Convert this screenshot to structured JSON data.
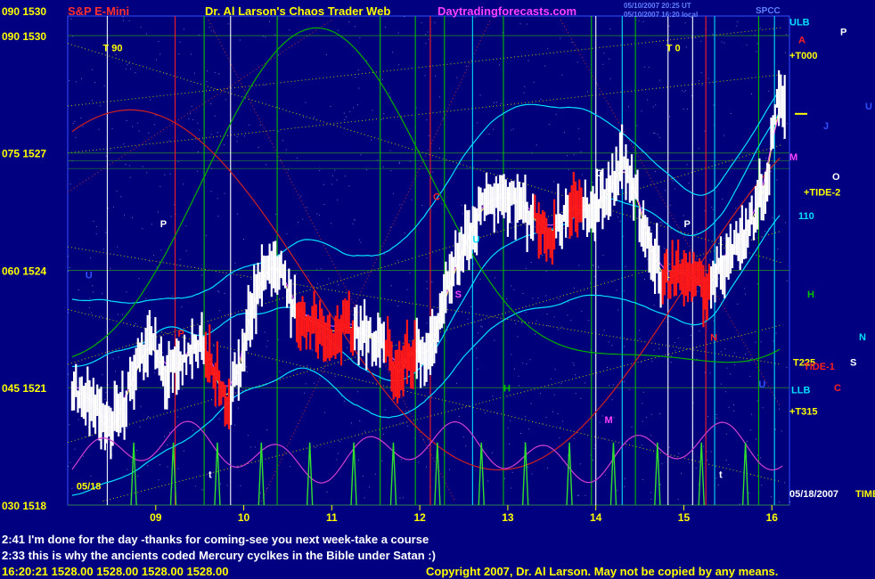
{
  "header": {
    "top_left_price": "090 1530",
    "symbol": "S&P E-Mini",
    "title": "Dr. Al Larson's Chaos Trader Web",
    "site": "Daytradingforecasts.com",
    "stamp1": "05/10/2007 20:25 UT",
    "stamp2": "05/10/2007 16:20 local",
    "corner": "SPCC"
  },
  "colors": {
    "bg": "#000080",
    "panel": "#00007a",
    "white": "#ffffff",
    "yellow": "#ffff00",
    "red": "#ff2020",
    "cyan": "#00e0ff",
    "green": "#00c000",
    "magenta": "#ff40ff",
    "orange": "#ff8000",
    "grid": "#3050ff",
    "copyright": "#ffff00"
  },
  "chart_data": {
    "type": "bar",
    "instrument": "S&P E-Mini",
    "price_axis": [
      {
        "label": "090 1530",
        "price": 1530
      },
      {
        "label": "075 1527",
        "price": 1527
      },
      {
        "label": "060 1524",
        "price": 1524
      },
      {
        "label": "045 1521",
        "price": 1521
      },
      {
        "label": "030 1518",
        "price": 1518
      }
    ],
    "time_axis": [
      "09",
      "10",
      "11",
      "12",
      "13",
      "14",
      "15",
      "16"
    ],
    "ylim": [
      1518,
      1530.5
    ],
    "xlim": [
      8.0,
      16.2
    ],
    "close_path": [
      [
        8.05,
        1521
      ],
      [
        8.3,
        1520.6
      ],
      [
        8.45,
        1519.8
      ],
      [
        8.6,
        1520.4
      ],
      [
        8.8,
        1521.6
      ],
      [
        8.95,
        1522.2
      ],
      [
        9.1,
        1521.3
      ],
      [
        9.3,
        1521.6
      ],
      [
        9.5,
        1522.3
      ],
      [
        9.65,
        1521.4
      ],
      [
        9.8,
        1520.6
      ],
      [
        9.95,
        1521.5
      ],
      [
        10.1,
        1523.2
      ],
      [
        10.3,
        1524.2
      ],
      [
        10.45,
        1523.8
      ],
      [
        10.6,
        1522.8
      ],
      [
        10.8,
        1522.7
      ],
      [
        11.0,
        1522.4
      ],
      [
        11.2,
        1522.6
      ],
      [
        11.4,
        1522.3
      ],
      [
        11.6,
        1522.1
      ],
      [
        11.75,
        1521.2
      ],
      [
        11.9,
        1522.0
      ],
      [
        12.1,
        1521.8
      ],
      [
        12.3,
        1523.4
      ],
      [
        12.5,
        1524.6
      ],
      [
        12.7,
        1525.6
      ],
      [
        12.9,
        1525.9
      ],
      [
        13.1,
        1525.8
      ],
      [
        13.3,
        1525.3
      ],
      [
        13.5,
        1524.9
      ],
      [
        13.7,
        1525.6
      ],
      [
        13.9,
        1525.5
      ],
      [
        14.1,
        1525.8
      ],
      [
        14.3,
        1526.7
      ],
      [
        14.45,
        1526.0
      ],
      [
        14.6,
        1524.6
      ],
      [
        14.8,
        1523.7
      ],
      [
        14.95,
        1524.0
      ],
      [
        15.1,
        1523.8
      ],
      [
        15.25,
        1523.4
      ],
      [
        15.4,
        1524.2
      ],
      [
        15.6,
        1524.6
      ],
      [
        15.8,
        1525.4
      ],
      [
        15.95,
        1526.4
      ],
      [
        16.05,
        1528.2
      ],
      [
        16.15,
        1528.3
      ]
    ],
    "red_bar_zones": [
      [
        9.55,
        9.85
      ],
      [
        10.6,
        11.25
      ],
      [
        11.6,
        11.95
      ],
      [
        13.3,
        13.55
      ],
      [
        13.7,
        13.85
      ],
      [
        14.75,
        15.3
      ]
    ],
    "last": {
      "time": "16:20:21",
      "open": 1528.0,
      "high": 1528.0,
      "low": 1528.0,
      "close": 1528.0
    }
  },
  "overlays": {
    "time_lines": [
      {
        "t": 8.45,
        "color": "white"
      },
      {
        "t": 9.22,
        "color": "red"
      },
      {
        "t": 9.55,
        "color": "green"
      },
      {
        "t": 9.85,
        "color": "white"
      },
      {
        "t": 10.38,
        "color": "green"
      },
      {
        "t": 11.55,
        "color": "green"
      },
      {
        "t": 11.95,
        "color": "green"
      },
      {
        "t": 12.12,
        "color": "red"
      },
      {
        "t": 12.28,
        "color": "green"
      },
      {
        "t": 12.6,
        "color": "cyan"
      },
      {
        "t": 12.95,
        "color": "green"
      },
      {
        "t": 13.95,
        "color": "green"
      },
      {
        "t": 14.0,
        "color": "white"
      },
      {
        "t": 14.3,
        "color": "cyan"
      },
      {
        "t": 14.45,
        "color": "green"
      },
      {
        "t": 14.82,
        "color": "white"
      },
      {
        "t": 15.1,
        "color": "white"
      },
      {
        "t": 15.25,
        "color": "red"
      },
      {
        "t": 15.35,
        "color": "cyan"
      },
      {
        "t": 15.85,
        "color": "green"
      },
      {
        "t": 16.03,
        "color": "cyan"
      }
    ],
    "cycle_labels": [
      {
        "text": "T 90",
        "t": 8.4,
        "p": 1529.6,
        "color": "yellow"
      },
      {
        "text": "T 0",
        "t": 14.8,
        "p": 1529.6,
        "color": "yellow"
      },
      {
        "text": "P",
        "t": 9.05,
        "p": 1525.1,
        "color": "white"
      },
      {
        "text": "C",
        "t": 12.15,
        "p": 1525.8,
        "color": "red"
      },
      {
        "text": "O",
        "t": 14.0,
        "p": 1526.4,
        "color": "white"
      },
      {
        "text": "P",
        "t": 15.0,
        "p": 1525.1,
        "color": "white"
      },
      {
        "text": "U",
        "t": 8.2,
        "p": 1523.8,
        "color": "blue"
      },
      {
        "text": "P",
        "t": 9.25,
        "p": 1522.3,
        "color": "red"
      },
      {
        "text": "S",
        "t": 12.4,
        "p": 1523.3,
        "color": "magenta"
      },
      {
        "text": "U",
        "t": 12.6,
        "p": 1524.7,
        "color": "cyan"
      },
      {
        "text": "H",
        "t": 12.95,
        "p": 1520.9,
        "color": "green"
      },
      {
        "text": "M",
        "t": 14.1,
        "p": 1520.1,
        "color": "magenta"
      },
      {
        "text": "N",
        "t": 15.3,
        "p": 1522.2,
        "color": "red"
      },
      {
        "text": "t",
        "t": 9.6,
        "p": 1518.7,
        "color": "white"
      },
      {
        "text": "t",
        "t": 15.4,
        "p": 1518.7,
        "color": "white"
      },
      {
        "text": "U",
        "t": 15.85,
        "p": 1521.0,
        "color": "blue"
      },
      {
        "text": "05/18",
        "t": 8.1,
        "p": 1518.4,
        "color": "yellow"
      }
    ],
    "right_labels": [
      {
        "text": "ULB",
        "p": 1530.35,
        "x_off": 0,
        "color": "cyan"
      },
      {
        "text": "A",
        "p": 1529.9,
        "x_off": 10,
        "color": "red"
      },
      {
        "text": "P",
        "p": 1530.1,
        "x_off": 57,
        "color": "white"
      },
      {
        "text": "+T000",
        "p": 1529.5,
        "x_off": 0,
        "color": "yellow"
      },
      {
        "text": "J",
        "p": 1527.7,
        "x_off": 38,
        "color": "blue"
      },
      {
        "text": "U",
        "p": 1528.2,
        "x_off": 85,
        "color": "blue"
      },
      {
        "text": "M",
        "p": 1526.9,
        "x_off": 0,
        "color": "magenta"
      },
      {
        "text": "O",
        "p": 1526.4,
        "x_off": 48,
        "color": "white"
      },
      {
        "text": "+TIDE-2",
        "p": 1526.0,
        "x_off": 16,
        "color": "yellow"
      },
      {
        "text": "110",
        "p": 1525.4,
        "x_off": 10,
        "color": "cyan"
      },
      {
        "text": "H",
        "p": 1523.4,
        "x_off": 20,
        "color": "green"
      },
      {
        "text": "N",
        "p": 1522.3,
        "x_off": 78,
        "color": "cyan"
      },
      {
        "text": "T225",
        "p": 1521.65,
        "x_off": 4,
        "color": "yellow"
      },
      {
        "text": "TIDE-1",
        "p": 1521.55,
        "x_off": 16,
        "color": "red"
      },
      {
        "text": "S",
        "p": 1521.65,
        "x_off": 68,
        "color": "white"
      },
      {
        "text": "LLB",
        "p": 1520.95,
        "x_off": 2,
        "color": "cyan"
      },
      {
        "text": "C",
        "p": 1521.0,
        "x_off": 50,
        "color": "red"
      },
      {
        "text": "+T315",
        "p": 1520.4,
        "x_off": 0,
        "color": "yellow"
      },
      {
        "text": "05/18/2007",
        "p": 1518.3,
        "x_off": 0,
        "color": "white"
      },
      {
        "text": "TIME",
        "p": 1518.3,
        "x_off": 74,
        "color": "yellow"
      }
    ]
  },
  "annotations": [
    "2:41 I'm done for the day -thanks for coming-see you next week-take a course",
    "2:33 this is why the ancients coded Mercury cyclkes in the Bible under Satan :)"
  ],
  "footer": {
    "quote": "16:20:21  1528.00  1528.00  1528.00  1528.00",
    "copyright": "Copyright 2007, Dr. Al Larson. May not be copied by any means."
  }
}
